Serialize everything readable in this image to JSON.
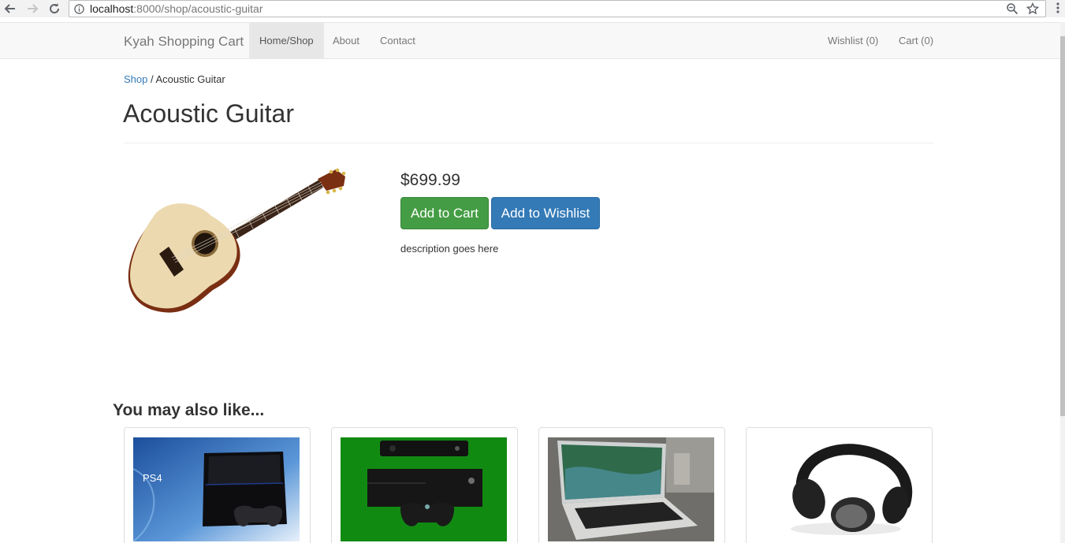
{
  "browser": {
    "url_host": "localhost",
    "url_path": ":8000/shop/acoustic-guitar"
  },
  "navbar": {
    "brand": "Kyah Shopping Cart",
    "links": [
      {
        "label": "Home/Shop",
        "active": true
      },
      {
        "label": "About",
        "active": false
      },
      {
        "label": "Contact",
        "active": false
      }
    ],
    "wishlist": "Wishlist (0)",
    "cart": "Cart (0)"
  },
  "breadcrumb": {
    "shop": "Shop",
    "separator": " / ",
    "current": "Acoustic Guitar"
  },
  "product": {
    "title": "Acoustic Guitar",
    "price": "$699.99",
    "add_to_cart": "Add to Cart",
    "add_to_wishlist": "Add to Wishlist",
    "description": "description goes here",
    "image": "acoustic-guitar-image"
  },
  "related": {
    "heading": "You may also like...",
    "items": [
      {
        "image": "ps4-console-image",
        "logo": "PS4"
      },
      {
        "image": "xbox-one-console-image"
      },
      {
        "image": "macbook-pro-laptop-image"
      },
      {
        "image": "bose-headphones-image"
      }
    ]
  },
  "colors": {
    "success": "#449d44",
    "primary": "#337ab7",
    "link": "#337ab7",
    "navbar_bg": "#f8f8f8"
  }
}
